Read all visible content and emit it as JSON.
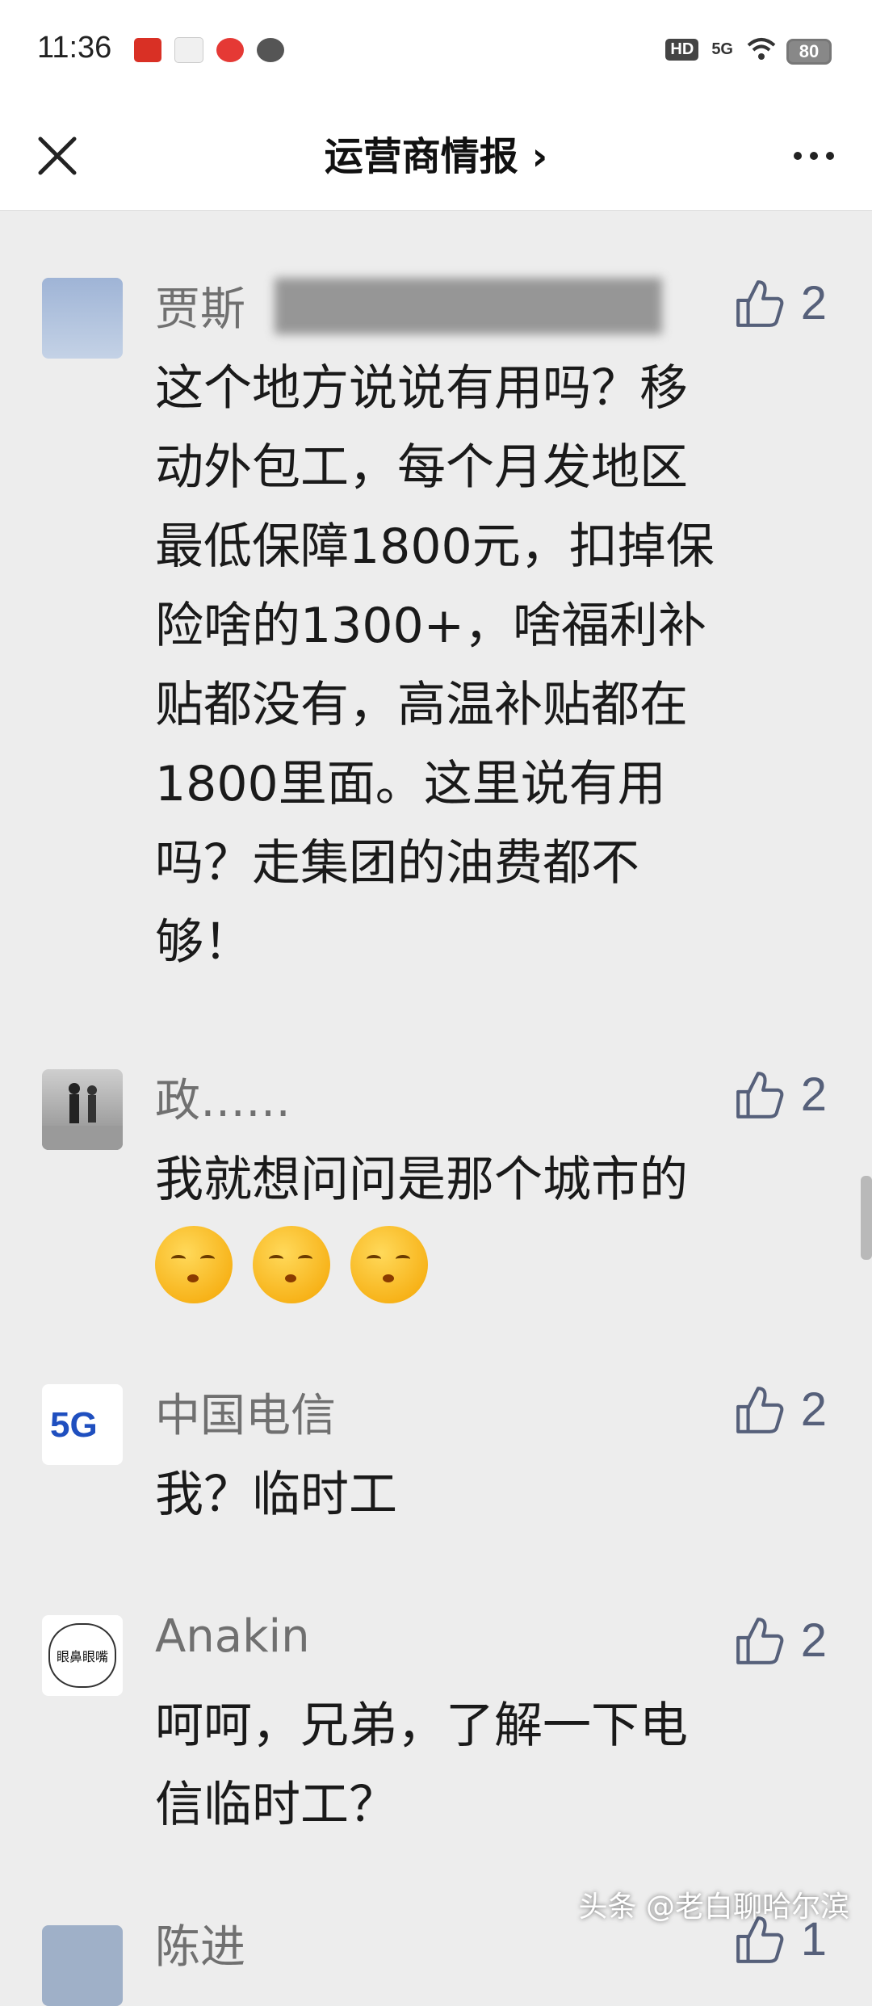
{
  "status": {
    "time": "11:36",
    "hd": "HD",
    "net": "5G",
    "battery": "80"
  },
  "nav": {
    "title": "运营商情报 ›"
  },
  "comments": [
    {
      "name": "贾斯",
      "likes": "2",
      "lines": [
        "这个地方说说有用吗？移",
        "动外包工，每个月发地区",
        "最低保障1800元，扣掉保",
        "险啥的1300+，啥福利补",
        "贴都没有，高温补贴都在",
        "1800里面。这里说有用",
        "吗？走集团的油费都不",
        "够！"
      ]
    },
    {
      "name": "政……",
      "likes": "2",
      "lines": [
        "我就想问问是那个城市的"
      ]
    },
    {
      "name": "中国电信",
      "likes": "2",
      "lines": [
        "我？临时工"
      ],
      "avatar_text": "5G"
    },
    {
      "name": "Anakin",
      "likes": "2",
      "lines": [
        "呵呵，兄弟，了解一下电",
        "信临时工？"
      ],
      "avatar_text": "眼鼻眼嘴"
    },
    {
      "name": "陈进",
      "likes": "1"
    }
  ],
  "watermark": "头条 @老白聊哈尔滨"
}
